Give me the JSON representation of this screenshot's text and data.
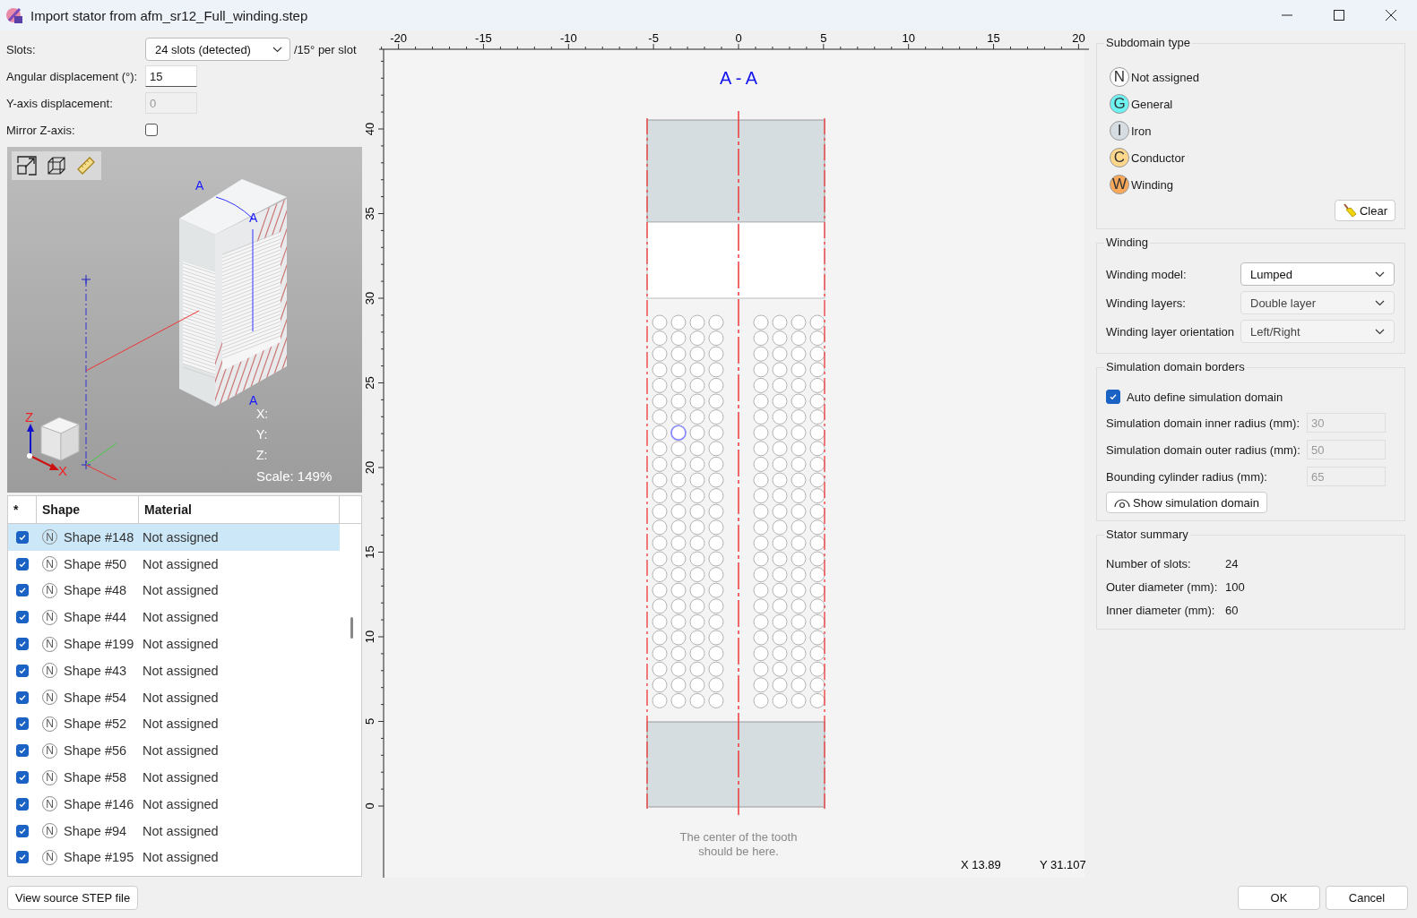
{
  "window": {
    "title": "Import stator from afm_sr12_Full_winding.step"
  },
  "form": {
    "slots_label": "Slots:",
    "slots_value": "24 slots (detected)",
    "slots_suffix": "/15° per slot",
    "angular_label": "Angular displacement (°):",
    "angular_value": "15",
    "y_label": "Y-axis displacement:",
    "y_value": "0",
    "y_disabled": true,
    "mirror_label": "Mirror Z-axis:",
    "mirror_checked": false
  },
  "viewer": {
    "section_labels": [
      "A",
      "A",
      "A"
    ],
    "axis_labels": [
      "Z",
      "X"
    ],
    "coords": [
      "X:",
      "Y:",
      "Z:"
    ],
    "scale": "Scale: 149%"
  },
  "table": {
    "columns": [
      "*",
      "Shape",
      "Material"
    ],
    "rows": [
      {
        "checked": true,
        "badge": "N",
        "shape": "Shape #148",
        "material": "Not assigned",
        "selected": true
      },
      {
        "checked": true,
        "badge": "N",
        "shape": "Shape #50",
        "material": "Not assigned",
        "selected": false
      },
      {
        "checked": true,
        "badge": "N",
        "shape": "Shape #48",
        "material": "Not assigned",
        "selected": false
      },
      {
        "checked": true,
        "badge": "N",
        "shape": "Shape #44",
        "material": "Not assigned",
        "selected": false
      },
      {
        "checked": true,
        "badge": "N",
        "shape": "Shape #199",
        "material": "Not assigned",
        "selected": false
      },
      {
        "checked": true,
        "badge": "N",
        "shape": "Shape #43",
        "material": "Not assigned",
        "selected": false
      },
      {
        "checked": true,
        "badge": "N",
        "shape": "Shape #54",
        "material": "Not assigned",
        "selected": false
      },
      {
        "checked": true,
        "badge": "N",
        "shape": "Shape #52",
        "material": "Not assigned",
        "selected": false
      },
      {
        "checked": true,
        "badge": "N",
        "shape": "Shape #56",
        "material": "Not assigned",
        "selected": false
      },
      {
        "checked": true,
        "badge": "N",
        "shape": "Shape #58",
        "material": "Not assigned",
        "selected": false
      },
      {
        "checked": true,
        "badge": "N",
        "shape": "Shape #146",
        "material": "Not assigned",
        "selected": false
      },
      {
        "checked": true,
        "badge": "N",
        "shape": "Shape #94",
        "material": "Not assigned",
        "selected": false
      },
      {
        "checked": true,
        "badge": "N",
        "shape": "Shape #195",
        "material": "Not assigned",
        "selected": false
      }
    ]
  },
  "drawing": {
    "x_ticks": [
      "-20",
      "-15",
      "-10",
      "-5",
      "0",
      "5",
      "10",
      "15",
      "20"
    ],
    "y_ticks": [
      "0",
      "5",
      "10",
      "15",
      "20",
      "25",
      "30",
      "35",
      "40"
    ],
    "title": "A - A",
    "hint": [
      "The center of the tooth",
      "should be here."
    ],
    "cursor_x": "X 13.89",
    "cursor_y": "Y 31.107"
  },
  "subdomain_type": {
    "title": "Subdomain type",
    "types": [
      {
        "symbol": "N",
        "label": "Not assigned",
        "color": "#ffffff"
      },
      {
        "symbol": "G",
        "label": "General",
        "color": "#6ef3f3"
      },
      {
        "symbol": "I",
        "label": "Iron",
        "color": "#d6dde2"
      },
      {
        "symbol": "C",
        "label": "Conductor",
        "color": "#fdd88c"
      },
      {
        "symbol": "W",
        "label": "Winding",
        "color": "#f9a85a"
      }
    ],
    "clear": "Clear"
  },
  "winding": {
    "title": "Winding",
    "fields": [
      {
        "label": "Winding model:",
        "value": "Lumped",
        "disabled": false
      },
      {
        "label": "Winding layers:",
        "value": "Double layer",
        "disabled": true
      },
      {
        "label": "Winding layer orientation",
        "value": "Left/Right",
        "disabled": true
      }
    ]
  },
  "simulation_domain": {
    "title": "Simulation domain borders",
    "auto_label": "Auto define simulation domain",
    "auto_checked": true,
    "fields": [
      {
        "label": "Simulation domain inner radius (mm):",
        "value": "30",
        "disabled": true
      },
      {
        "label": "Simulation domain outer radius (mm):",
        "value": "50",
        "disabled": true
      },
      {
        "label": "Bounding cylinder radius (mm):",
        "value": "65",
        "disabled": true
      }
    ],
    "show_button": "Show simulation domain"
  },
  "stator_summary": {
    "title": "Stator summary",
    "items": [
      {
        "label": "Number of slots:",
        "value": "24"
      },
      {
        "label": "Outer diameter (mm):",
        "value": "100"
      },
      {
        "label": "Inner diameter (mm):",
        "value": "60"
      }
    ]
  },
  "footer": {
    "view_source": "View source STEP file",
    "ok": "OK",
    "cancel": "Cancel"
  }
}
